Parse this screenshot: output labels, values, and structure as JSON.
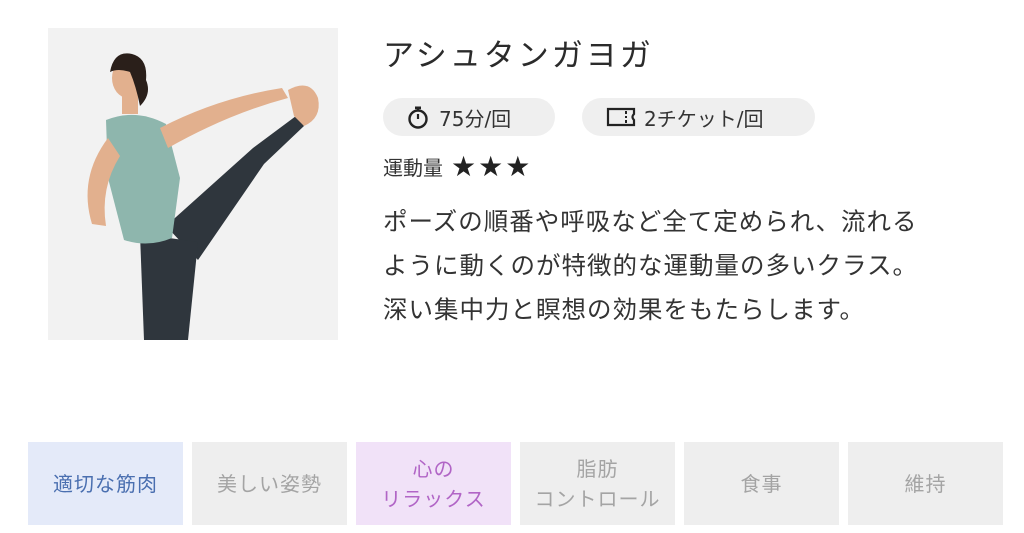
{
  "class": {
    "title": "アシュタンガヨガ",
    "duration": "75分/回",
    "tickets": "2チケット/回",
    "intensity_label": "運動量",
    "intensity_stars": "★★★",
    "intensity_level": 3,
    "description": [
      "ポーズの順番や呼吸など全て定められ、流れる",
      "ように動くのが特徴的な運動量の多いクラス。",
      "深い集中力と瞑想の効果をもたらします。"
    ]
  },
  "icons": {
    "duration": "stopwatch-icon",
    "tickets": "ticket-icon"
  },
  "tags": [
    {
      "lines": [
        "適切な筋肉"
      ],
      "state": "active-blue"
    },
    {
      "lines": [
        "美しい姿勢"
      ],
      "state": "inactive"
    },
    {
      "lines": [
        "心の",
        "リラックス"
      ],
      "state": "active-purple"
    },
    {
      "lines": [
        "脂肪",
        "コントロール"
      ],
      "state": "inactive"
    },
    {
      "lines": [
        "食事"
      ],
      "state": "inactive"
    },
    {
      "lines": [
        "維持"
      ],
      "state": "inactive"
    }
  ],
  "colors": {
    "active_blue_bg": "#e4eaf9",
    "active_blue_text": "#4a6fb0",
    "active_purple_bg": "#f1e2f8",
    "active_purple_text": "#b165c6",
    "inactive_bg": "#eeeeee",
    "inactive_text": "#a4a4a4",
    "pill_bg": "#efefef"
  }
}
